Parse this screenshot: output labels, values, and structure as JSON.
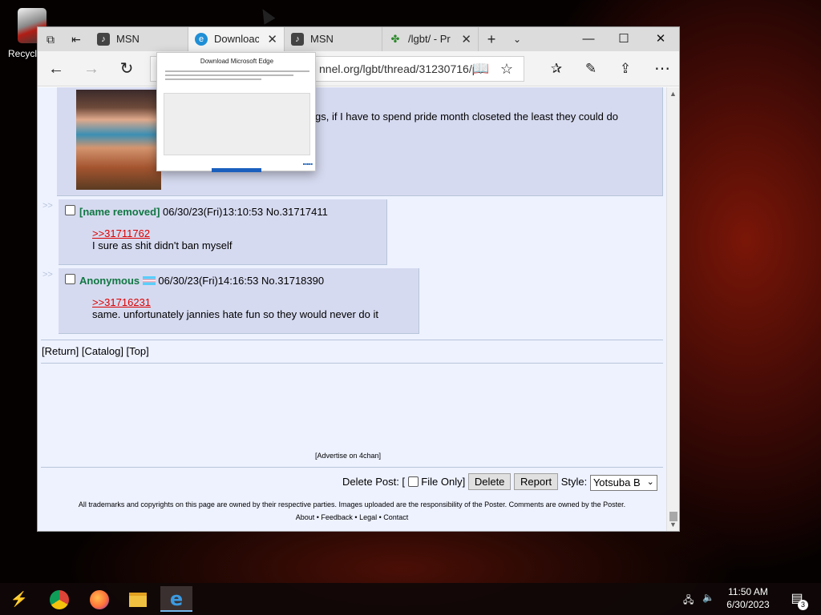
{
  "desktop": {
    "recycle_label": "Recycle"
  },
  "browser": {
    "tabs": [
      {
        "title": "MSN",
        "favicon": "msn-icon"
      },
      {
        "title": "Downloac",
        "favicon": "edge-icon"
      },
      {
        "title": "MSN",
        "favicon": "msn-icon"
      },
      {
        "title": "/lgbt/ - Pr",
        "favicon": "4chan-clover-icon"
      }
    ],
    "address": "nnel.org/lgbt/thread/31230716/p"
  },
  "popup": {
    "title": "Download Microsoft Edge"
  },
  "thread": {
    "op_text": "gs, if I have to spend pride month closeted the least they could do",
    "replies": [
      {
        "name": "[name removed]",
        "datetime": "06/30/23(Fri)13:10:53",
        "post_no": "No.31717411",
        "quote": ">>31711762",
        "message": "I sure as shit didn't ban myself"
      },
      {
        "name": "Anonymous",
        "datetime": "06/30/23(Fri)14:16:53",
        "post_no": "No.31718390",
        "quote": ">>31716231",
        "message": "same. unfortunately jannies hate fun so they would never do it"
      }
    ],
    "arrows": ">>",
    "nav": {
      "return": "Return",
      "catalog": "Catalog",
      "top": "Top"
    },
    "advertise": "[Advertise on 4chan]",
    "delete_post_label": "Delete Post: [",
    "file_only_label": "File Only]",
    "delete_button": "Delete",
    "report_button": "Report",
    "style_label": "Style:",
    "style_value": "Yotsuba B",
    "footer_text": "All trademarks and copyrights on this page are owned by their respective parties. Images uploaded are the responsibility of the Poster. Comments are owned by the Poster.",
    "footer_links": {
      "about": "About",
      "feedback": "Feedback",
      "legal": "Legal",
      "contact": "Contact"
    }
  },
  "taskbar": {
    "time": "11:50 AM",
    "date": "6/30/2023",
    "notification_count": "3"
  }
}
